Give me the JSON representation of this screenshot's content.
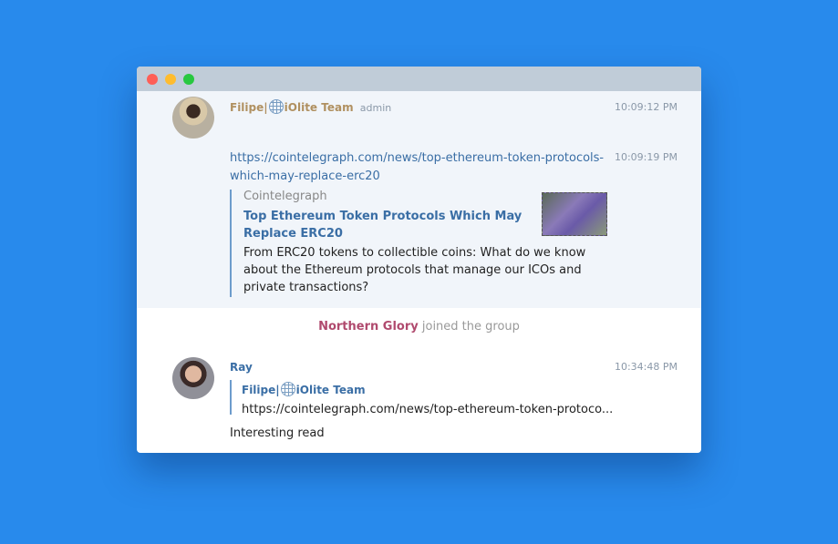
{
  "colors": {
    "background": "#288aec",
    "admin_name": "#b09060",
    "link": "#3a6ea5",
    "join_name": "#b04a6e"
  },
  "messages": [
    {
      "author": "Filipe|",
      "team": "iOlite Team",
      "role": "admin",
      "time": "10:09:12 PM"
    },
    {
      "time": "10:09:19 PM",
      "url_line1": "https://cointelegraph.com/news/top-ethereum-token-protocols-",
      "url_line2": "which-may-replace-erc20",
      "preview": {
        "site": "Cointelegraph",
        "title_line1": "Top Ethereum Token Protocols Which May",
        "title_line2": "Replace ERC20",
        "desc_line1": "From ERC20 tokens to collectible coins: What do we know",
        "desc_line2": "about the Ethereum protocols that manage our ICOs and",
        "desc_line3": "private transactions?"
      }
    }
  ],
  "service": {
    "name": "Northern Glory",
    "text": "joined the group"
  },
  "reply": {
    "author": "Ray",
    "time": "10:34:48 PM",
    "quote_author": "Filipe|",
    "quote_team": "iOlite Team",
    "quote_text": "https://cointelegraph.com/news/top-ethereum-token-protoco...",
    "text": "Interesting read"
  }
}
